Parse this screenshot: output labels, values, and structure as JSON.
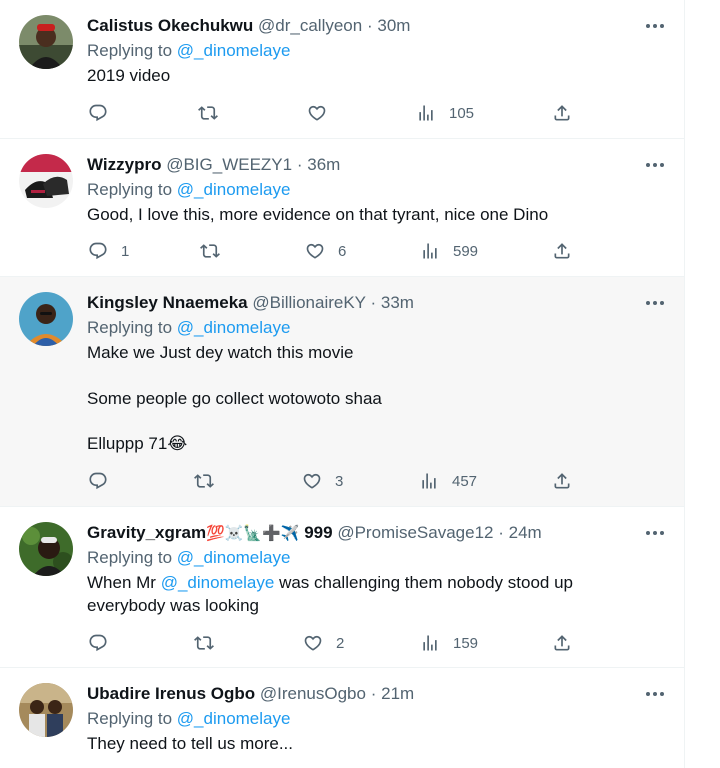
{
  "tweets": [
    {
      "name": "Calistus Okechukwu",
      "handle": "@dr_callyeon",
      "time": "30m",
      "replying_label": "Replying to",
      "replying_to": "@_dinomelaye",
      "text_lines": [
        "2019 video"
      ],
      "replies": "",
      "retweets": "",
      "likes": "",
      "views": "105"
    },
    {
      "name": "Wizzypro",
      "handle": "@BIG_WEEZY1",
      "time": "36m",
      "replying_label": "Replying to",
      "replying_to": "@_dinomelaye",
      "text_lines": [
        "Good, I love this, more evidence on that tyrant, nice one Dino"
      ],
      "replies": "1",
      "retweets": "",
      "likes": "6",
      "views": "599"
    },
    {
      "name": "Kingsley Nnaemeka",
      "handle": "@BillionaireKY",
      "time": "33m",
      "replying_label": "Replying to",
      "replying_to": "@_dinomelaye",
      "text_lines": [
        "Make we Just dey watch this movie",
        "Some people go collect wotowoto shaa",
        "Elluppp 71😂"
      ],
      "replies": "",
      "retweets": "",
      "likes": "3",
      "views": "457"
    },
    {
      "name": "Gravity_xgram",
      "name_emoji": "💯☠️🗽➕✈️",
      "name_suffix": "999",
      "handle": "@PromiseSavage12",
      "time": "24m",
      "replying_label": "Replying to",
      "replying_to": "@_dinomelaye",
      "text_prefix": "When Mr ",
      "text_mention": "@_dinomelaye",
      "text_suffix": " was challenging them nobody stood up",
      "text_line2": "everybody was looking",
      "replies": "",
      "retweets": "",
      "likes": "2",
      "views": "159"
    },
    {
      "name": "Ubadire Irenus Ogbo",
      "handle": "@IrenusOgbo",
      "time": "21m",
      "replying_label": "Replying to",
      "replying_to": "@_dinomelaye",
      "text_lines": [
        "They need to tell us more..."
      ]
    }
  ],
  "separator": "·",
  "icons": {
    "reply": "reply-icon",
    "retweet": "retweet-icon",
    "like": "heart-icon",
    "views": "views-icon",
    "share": "share-icon",
    "more": "more-options-icon"
  },
  "colors": {
    "text": "#0f1419",
    "secondary": "#536471",
    "link": "#1d9bf0",
    "highlight_bg": "#f7f7f7",
    "border": "#eff3f4"
  }
}
